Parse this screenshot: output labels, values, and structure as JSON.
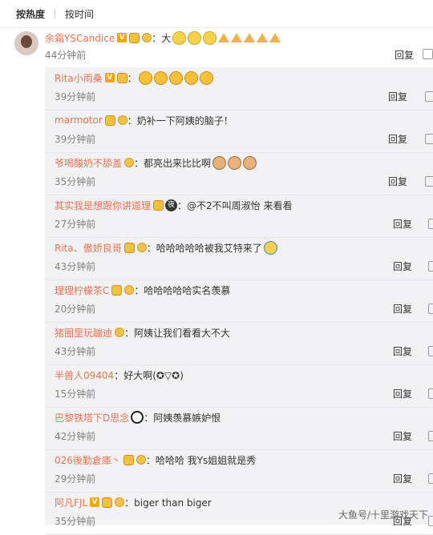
{
  "tabs": {
    "hot": "按热度",
    "time": "按时间"
  },
  "main_comment": {
    "user": "余霜YSCandice",
    "text": "：大",
    "time": "44分钟前",
    "reply": "回复"
  },
  "replies": [
    {
      "user": "Rita小雨桑",
      "text": "：",
      "time": "39分钟前",
      "reply": "回复",
      "badges": [
        "v",
        "lv"
      ],
      "emojis": [
        "angry",
        "angry",
        "angry",
        "angry",
        "angry"
      ]
    },
    {
      "user": "marmotor",
      "text": "：奶补一下阿姨的脑子！",
      "time": "39分钟前",
      "reply": "回复",
      "badges": [
        "lv",
        "medal"
      ],
      "emojis": []
    },
    {
      "user": "爷喝酸奶不舔盖",
      "text": "：都亮出来比比啊",
      "time": "35分钟前",
      "reply": "回复",
      "badges": [
        "medal"
      ],
      "emojis": [
        "dog",
        "dog",
        "dog"
      ]
    },
    {
      "user": "其实我是想跟你讲道理",
      "text": "：@不2不叫周淑怡 来看看",
      "time": "27分钟前",
      "reply": "回复",
      "badges": [
        "lv",
        "night"
      ],
      "emojis": []
    },
    {
      "user": "Rita、傲娇良哥",
      "text": "：哈哈哈哈哈被我艾特来了",
      "time": "43分钟前",
      "reply": "回复",
      "badges": [
        "lv",
        "medal"
      ],
      "emojis": [
        "cry"
      ]
    },
    {
      "user": "理理柠檬茶C",
      "text": "：哈哈哈哈哈实名羡慕",
      "time": "20分钟前",
      "reply": "回复",
      "badges": [
        "lv",
        "medal"
      ],
      "emojis": []
    },
    {
      "user": "猪圈里玩蹦迪",
      "text": "：阿姨让我们看看大不大",
      "time": "43分钟前",
      "reply": "回复",
      "badges": [
        "medal"
      ],
      "emojis": []
    },
    {
      "user": "半兽人09404",
      "text": "：好大啊(✪▽✪)",
      "time": "15分钟前",
      "reply": "回复",
      "badges": [],
      "emojis": []
    },
    {
      "user": "巴黎铁塔下D思念",
      "text": "：阿姨羡慕嫉妒恨",
      "time": "42分钟前",
      "reply": "回复",
      "badges": [
        "panda"
      ],
      "emojis": []
    },
    {
      "user": "026後勤倉庫丶",
      "text": "：哈哈哈 我Ys姐姐就是秀",
      "time": "29分钟前",
      "reply": "回复",
      "badges": [
        "lv",
        "medal"
      ],
      "emojis": []
    },
    {
      "user": "阿凡FJL",
      "text": "：biger than biger",
      "time": "35分钟前",
      "reply": "回复",
      "badges": [
        "v",
        "lv",
        "medal"
      ],
      "emojis": []
    }
  ],
  "watermark": "大鱼号/十里游戏天下",
  "colors": {
    "username": "#eb7350",
    "meta": "#808080",
    "reply_bg": "#f2f2f5"
  }
}
